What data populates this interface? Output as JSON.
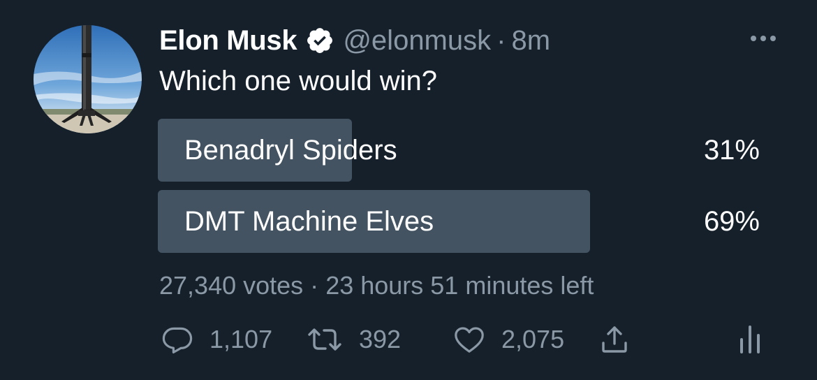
{
  "tweet": {
    "author": {
      "display_name": "Elon Musk",
      "handle": "@elonmusk",
      "verified": true,
      "avatar": "rocket-booster-avatar"
    },
    "separator": "·",
    "time": "8m",
    "text": "Which one would win?",
    "menu_icon": "more-dots-icon"
  },
  "poll": {
    "options": [
      {
        "label": "Benadryl Spiders",
        "percent_label": "31%",
        "fraction": 0.31
      },
      {
        "label": "DMT Machine Elves",
        "percent_label": "69%",
        "fraction": 0.69
      }
    ],
    "votes": "27,340 votes",
    "separator": "·",
    "time_left": "23 hours 51 minutes left"
  },
  "actions": {
    "reply": {
      "icon": "reply-bubble-icon",
      "count": "1,107"
    },
    "retweet": {
      "icon": "retweet-icon",
      "count": "392"
    },
    "like": {
      "icon": "heart-icon",
      "count": "2,075"
    },
    "share": {
      "icon": "share-upload-icon"
    },
    "analytics": {
      "icon": "analytics-bars-icon"
    }
  },
  "colors": {
    "background": "#15202b",
    "poll_bar": "#435361",
    "secondary_text": "#8b98a5",
    "primary_text": "#ffffff"
  }
}
